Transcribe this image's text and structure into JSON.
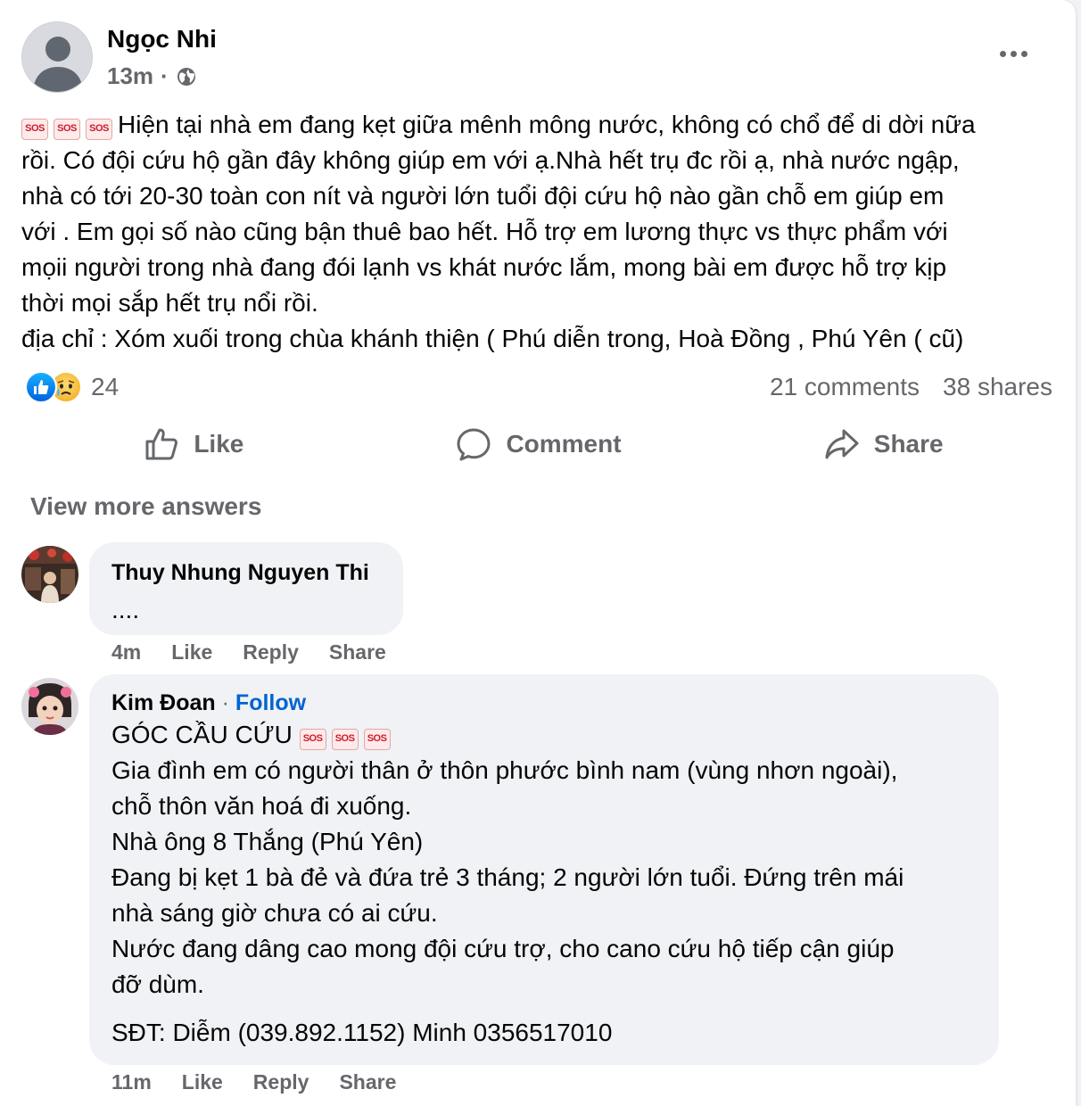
{
  "post": {
    "author": "Ngọc Nhi",
    "time": "13m",
    "separator": "·",
    "sos_label": "SOS",
    "line1": "Hiện tại nhà em đang kẹt giữa mênh mông nước,  không có chổ để di dời nữa",
    "lines": [
      "rồi. Có đội cứu hộ gần đây không giúp em với ạ.Nhà hết trụ đc rồi ạ, nhà nước ngập,",
      "nhà có tới 20-30 toàn con nít và người lớn tuổi đội cứu hộ nào gần chỗ em giúp em",
      "với . Em gọi số nào cũng bận thuê bao hết. Hỗ trợ em lương thực vs thực phẩm với",
      "mọii người trong nhà đang đói lạnh vs khát nước lắm, mong bài em được hỗ trợ kịp",
      "thời mọi sắp hết trụ nổi rồi.",
      "địa chỉ : Xóm xuối trong chùa khánh thiện ( Phú diễn trong, Hoà Đồng , Phú Yên ( cũ)"
    ],
    "reaction_count": "24",
    "comments_count": "21 comments",
    "shares_count": "38 shares"
  },
  "actions": {
    "like": "Like",
    "comment": "Comment",
    "share": "Share"
  },
  "view_more": "View more answers",
  "comments": [
    {
      "name": "Thuy Nhung Nguyen Thi",
      "text": "....",
      "time": "4m",
      "like": "Like",
      "reply": "Reply",
      "share": "Share"
    },
    {
      "name": "Kim Đoan",
      "separator": "·",
      "follow": "Follow",
      "title": "GÓC CẦU CỨU",
      "lines": [
        "Gia đình em có người thân ở thôn phước bình nam (vùng nhơn ngoài),",
        "chỗ thôn văn hoá đi xuống.",
        "Nhà ông 8 Thắng (Phú Yên)",
        "Đang bị kẹt 1 bà đẻ và đứa trẻ 3 tháng; 2 người lớn tuổi. Đứng trên mái",
        "nhà sáng giờ chưa có ai cứu.",
        "Nước đang dâng cao mong đội cứu trợ, cho cano cứu hộ tiếp cận giúp",
        "đỡ dùm."
      ],
      "phone": "SĐT: Diễm (039.892.1152) Minh 0356517010",
      "time": "11m",
      "like": "Like",
      "reply": "Reply",
      "share": "Share"
    }
  ],
  "colors": {
    "link": "#0064d1",
    "secondary_text": "#65676b",
    "bubble": "#f0f2f5"
  },
  "icons": [
    "globe-icon",
    "more-icon",
    "like-icon",
    "comment-icon",
    "share-icon",
    "sos-icon",
    "like-reaction-icon",
    "sad-reaction-icon"
  ]
}
